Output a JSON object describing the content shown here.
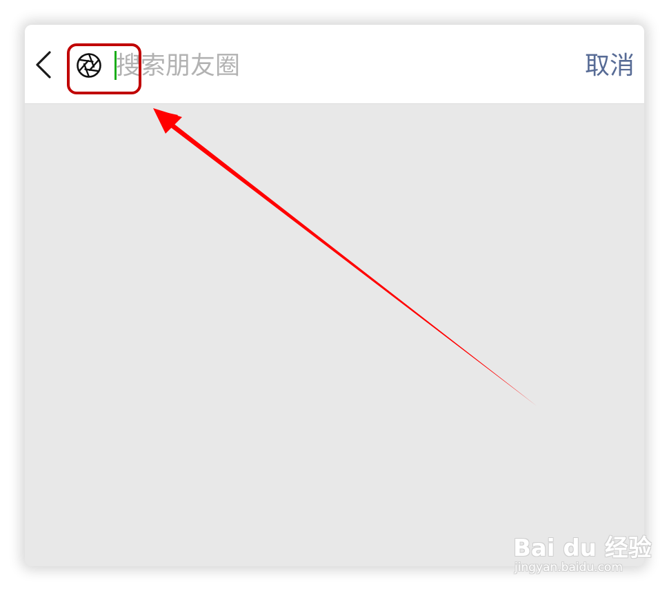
{
  "search": {
    "placeholder": "搜索朋友圈",
    "value": ""
  },
  "header": {
    "cancel_label": "取消"
  },
  "icons": {
    "back": "chevron-left-icon",
    "moments": "aperture-icon"
  },
  "annotation": {
    "highlight_color": "#c00000",
    "arrow_color": "#ff0000"
  },
  "watermark": {
    "logo_text": "Bai du 经验",
    "url": "jingyan.baidu.com"
  },
  "colors": {
    "accent_green": "#1aad19",
    "cancel_blue": "#576b95",
    "body_gray": "#e8e8e8"
  }
}
